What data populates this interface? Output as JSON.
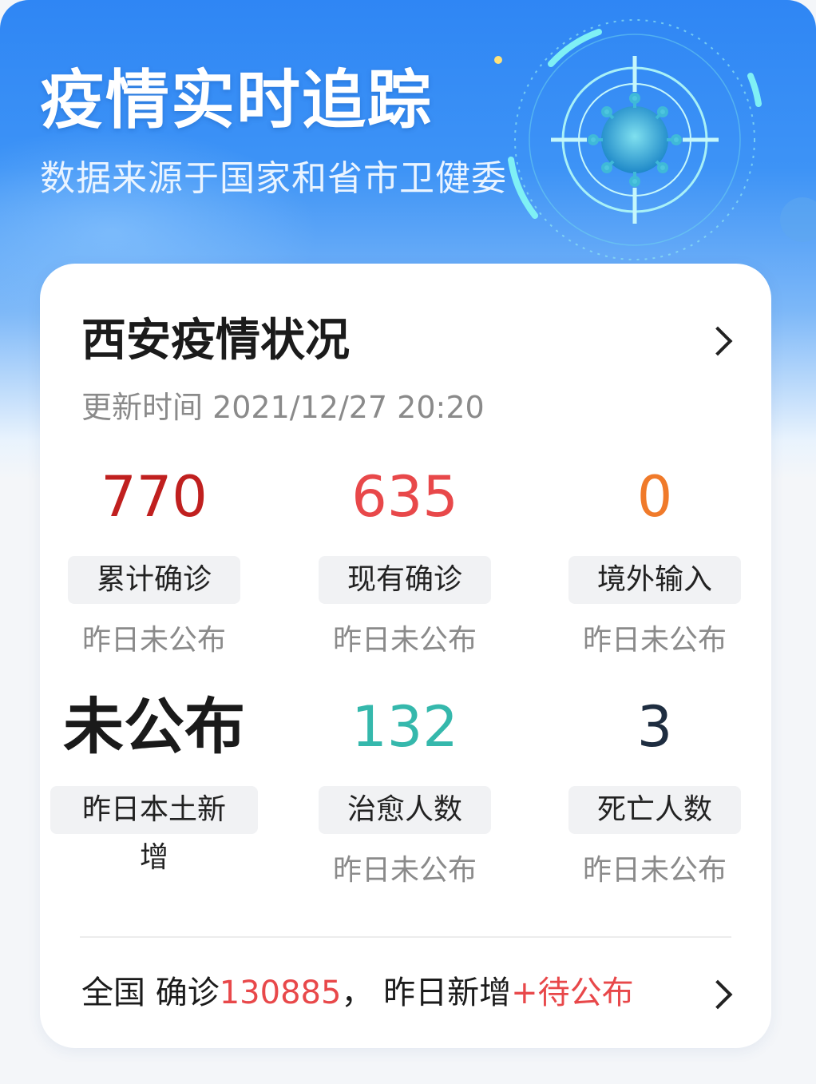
{
  "banner": {
    "title": "疫情实时追踪",
    "subtitle": "数据来源于国家和省市卫健委"
  },
  "card": {
    "title": "西安疫情状况",
    "update_time": "更新时间 2021/12/27 20:20",
    "stats": [
      {
        "value": "770",
        "label": "累计确诊",
        "sub": "昨日未公布",
        "color": "#c0201f"
      },
      {
        "value": "635",
        "label": "现有确诊",
        "sub": "昨日未公布",
        "color": "#e8484a"
      },
      {
        "value": "0",
        "label": "境外输入",
        "sub": "昨日未公布",
        "color": "#f07a2a"
      },
      {
        "value": "未公布",
        "label": "昨日本土新增",
        "sub": "",
        "color": "#1a1a1a"
      },
      {
        "value": "132",
        "label": "治愈人数",
        "sub": "昨日未公布",
        "color": "#35b8ac"
      },
      {
        "value": "3",
        "label": "死亡人数",
        "sub": "昨日未公布",
        "color": "#1e2d40"
      }
    ],
    "footer": {
      "prefix": "全国 确诊",
      "confirmed": "130885",
      "middle": "，  昨日新增",
      "new_value": "+待公布"
    }
  },
  "icons": {
    "header_chevron": "chevron-right-icon",
    "footer_chevron": "chevron-right-icon",
    "banner_virus": "virus-target-icon"
  }
}
